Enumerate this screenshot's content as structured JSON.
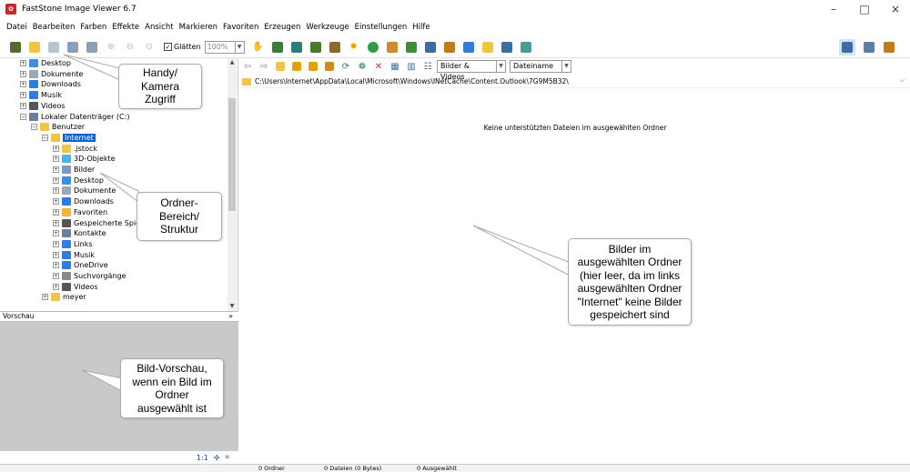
{
  "window": {
    "title": "FastStone Image Viewer 6.7",
    "minimize": "–",
    "maximize": "□",
    "close": "×"
  },
  "menu": [
    "Datei",
    "Bearbeiten",
    "Farben",
    "Effekte",
    "Ansicht",
    "Markieren",
    "Favoriten",
    "Erzeugen",
    "Werkzeuge",
    "Einstellungen",
    "Hilfe"
  ],
  "toolbar": {
    "smooth_label": "Glätten",
    "zoom_value": "100%"
  },
  "tree": [
    {
      "label": "Desktop",
      "indent": 0,
      "color": "#3a8ee6"
    },
    {
      "label": "Dokumente",
      "indent": 0,
      "color": "#9aa8b8"
    },
    {
      "label": "Downloads",
      "indent": 0,
      "color": "#2f7de1"
    },
    {
      "label": "Musik",
      "indent": 0,
      "color": "#2f7de1"
    },
    {
      "label": "Videos",
      "indent": 0,
      "color": "#555"
    },
    {
      "label": "Lokaler Datenträger (C:)",
      "indent": 0,
      "color": "#6a7f99"
    },
    {
      "label": "Benutzer",
      "indent": 1,
      "color": "#f2c446"
    },
    {
      "label": "Internet",
      "indent": 2,
      "color": "#f2c446",
      "selected": true
    },
    {
      "label": ".jstock",
      "indent": 3,
      "color": "#f2c446"
    },
    {
      "label": "3D-Objekte",
      "indent": 3,
      "color": "#4fb3e8"
    },
    {
      "label": "Bilder",
      "indent": 3,
      "color": "#7f9ab8"
    },
    {
      "label": "Desktop",
      "indent": 3,
      "color": "#3a8ee6"
    },
    {
      "label": "Dokumente",
      "indent": 3,
      "color": "#9aa8b8"
    },
    {
      "label": "Downloads",
      "indent": 3,
      "color": "#2f7de1"
    },
    {
      "label": "Favoriten",
      "indent": 3,
      "color": "#f2b631"
    },
    {
      "label": "Gespeicherte Spiele",
      "indent": 3,
      "color": "#555"
    },
    {
      "label": "Kontakte",
      "indent": 3,
      "color": "#6a7f99"
    },
    {
      "label": "Links",
      "indent": 3,
      "color": "#2f7de1"
    },
    {
      "label": "Musik",
      "indent": 3,
      "color": "#2f7de1"
    },
    {
      "label": "OneDrive",
      "indent": 3,
      "color": "#2f7de1"
    },
    {
      "label": "Suchvorgänge",
      "indent": 3,
      "color": "#888"
    },
    {
      "label": "Videos",
      "indent": 3,
      "color": "#555"
    },
    {
      "label": "meyer",
      "indent": 2,
      "color": "#f2c446"
    }
  ],
  "filter": {
    "type_value": "Bilder & Videos",
    "sort_value": "Dateiname"
  },
  "address": "C:\\Users\\Internet\\AppData\\Local\\Microsoft\\Windows\\INetCache\\Content.Outlook\\7G9M5B32\\",
  "main": {
    "empty_message": "Keine unterstützten Dateien im ausgewählten Ordner"
  },
  "preview": {
    "header": "Vorschau",
    "ratio_label": "1:1"
  },
  "status": {
    "folders": "0 Ordner",
    "files": "0 Dateien (0 Bytes)",
    "selected": "0 Ausgewählt"
  },
  "callouts": {
    "camera": [
      "Handy/",
      "Kamera",
      "Zugriff"
    ],
    "folder": [
      "Ordner-",
      "Bereich/",
      "Struktur"
    ],
    "preview": [
      "Bild-Vorschau,",
      "wenn ein Bild im",
      "Ordner",
      "ausgewählt ist"
    ],
    "images": [
      "Bilder im",
      "ausgewählten Ordner",
      "(hier leer, da im links",
      "ausgewählten Ordner",
      "\"Internet\" keine Bilder",
      "gespeichert sind"
    ]
  }
}
